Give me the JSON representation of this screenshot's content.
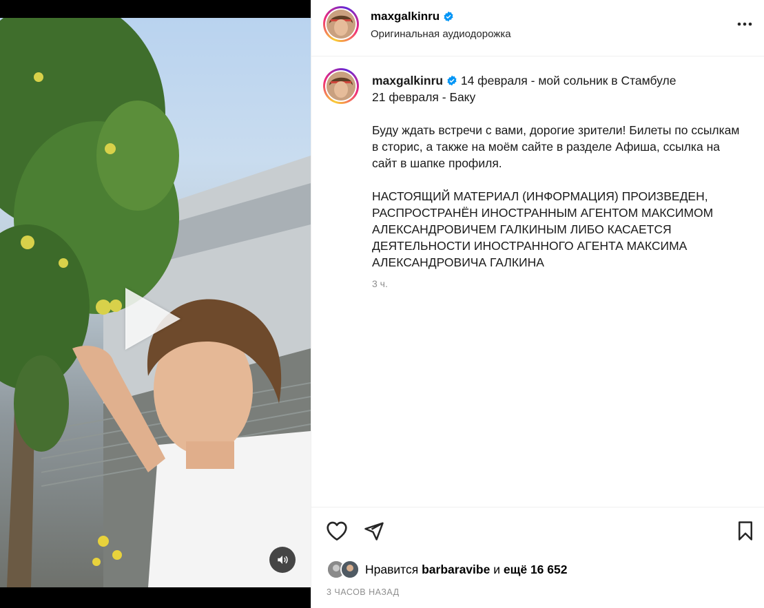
{
  "post": {
    "username": "maxgalkinru",
    "audio_label": "Оригинальная аудиодорожка",
    "caption": {
      "line1": "14 февраля - мой сольник в Стамбуле",
      "line2": "21 февраля - Баку",
      "para2": "Буду ждать встречи с вами, дорогие зрители! Билеты по ссылкам в сторис, а также на моём сайте в разделе Афиша, ссылка на сайт в шапке профиля.",
      "para3": "НАСТОЯЩИЙ МАТЕРИАЛ (ИНФОРМАЦИЯ) ПРОИЗВЕДЕН, РАСПРОСТРАНЁН ИНОСТРАННЫМ АГЕНТОМ МАКСИМОМ АЛЕКСАНДРОВИЧЕМ ГАЛКИНЫМ ЛИБО КАСАЕТСЯ ДЕЯТЕЛЬНОСТИ ИНОСТРАННОГО АГЕНТА МАКСИМА АЛЕКСАНДРОВИЧА ГАЛКИНА"
    },
    "caption_time": "3 ч.",
    "likes": {
      "prefix": "Нравится",
      "liker": "barbaravibe",
      "conj": "и",
      "more": "ещё 16 652"
    },
    "posted_ago": "3 ЧАСОВ НАЗАД"
  },
  "icons": {
    "more": "more-horizontal-icon",
    "like": "heart-icon",
    "share": "paper-plane-icon",
    "save": "bookmark-icon",
    "sound": "speaker-icon",
    "play": "play-icon",
    "verified": "verified-badge-icon"
  },
  "colors": {
    "verified_blue": "#0095f6",
    "muted_text": "#8e8e8e",
    "divider": "#efefef"
  }
}
